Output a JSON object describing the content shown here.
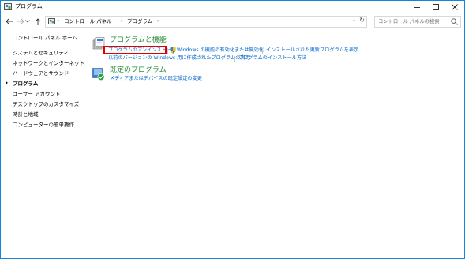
{
  "window": {
    "title": "プログラム",
    "accent": "#1883d7",
    "controls": {
      "minimize": "minimize-icon",
      "maximize": "maximize-icon",
      "close": "close-icon"
    }
  },
  "address": {
    "breadcrumb": [
      "コントロール パネル",
      "プログラム"
    ],
    "search_placeholder": "コントロール パネルの検索"
  },
  "sidebar": {
    "items": [
      {
        "label": "コントロール パネル ホーム",
        "current": false
      },
      {
        "label": "システムとセキュリティ",
        "current": false
      },
      {
        "label": "ネットワークとインターネット",
        "current": false
      },
      {
        "label": "ハードウェアとサウンド",
        "current": false
      },
      {
        "label": "プログラム",
        "current": true
      },
      {
        "label": "ユーザー アカウント",
        "current": false
      },
      {
        "label": "デスクトップのカスタマイズ",
        "current": false
      },
      {
        "label": "時計と地域",
        "current": false
      },
      {
        "label": "コンピューターの簡単操作",
        "current": false
      }
    ]
  },
  "main": {
    "programs_features": {
      "title": "プログラムと機能",
      "links": [
        "プログラムのアンインストール",
        "Windows の機能の有効化または無効化",
        "インストールされた更新プログラムを表示",
        "以前のバージョンの Windows 用に作成されたプログラムの実行",
        "プログラムのインストール方法"
      ]
    },
    "default_programs": {
      "title": "既定のプログラム",
      "links": [
        "メディアまたはデバイスの既定設定の変更"
      ]
    }
  },
  "colors": {
    "link": "#0066cc",
    "category_title": "#2d8d3c",
    "highlight_box": "#e00000"
  }
}
